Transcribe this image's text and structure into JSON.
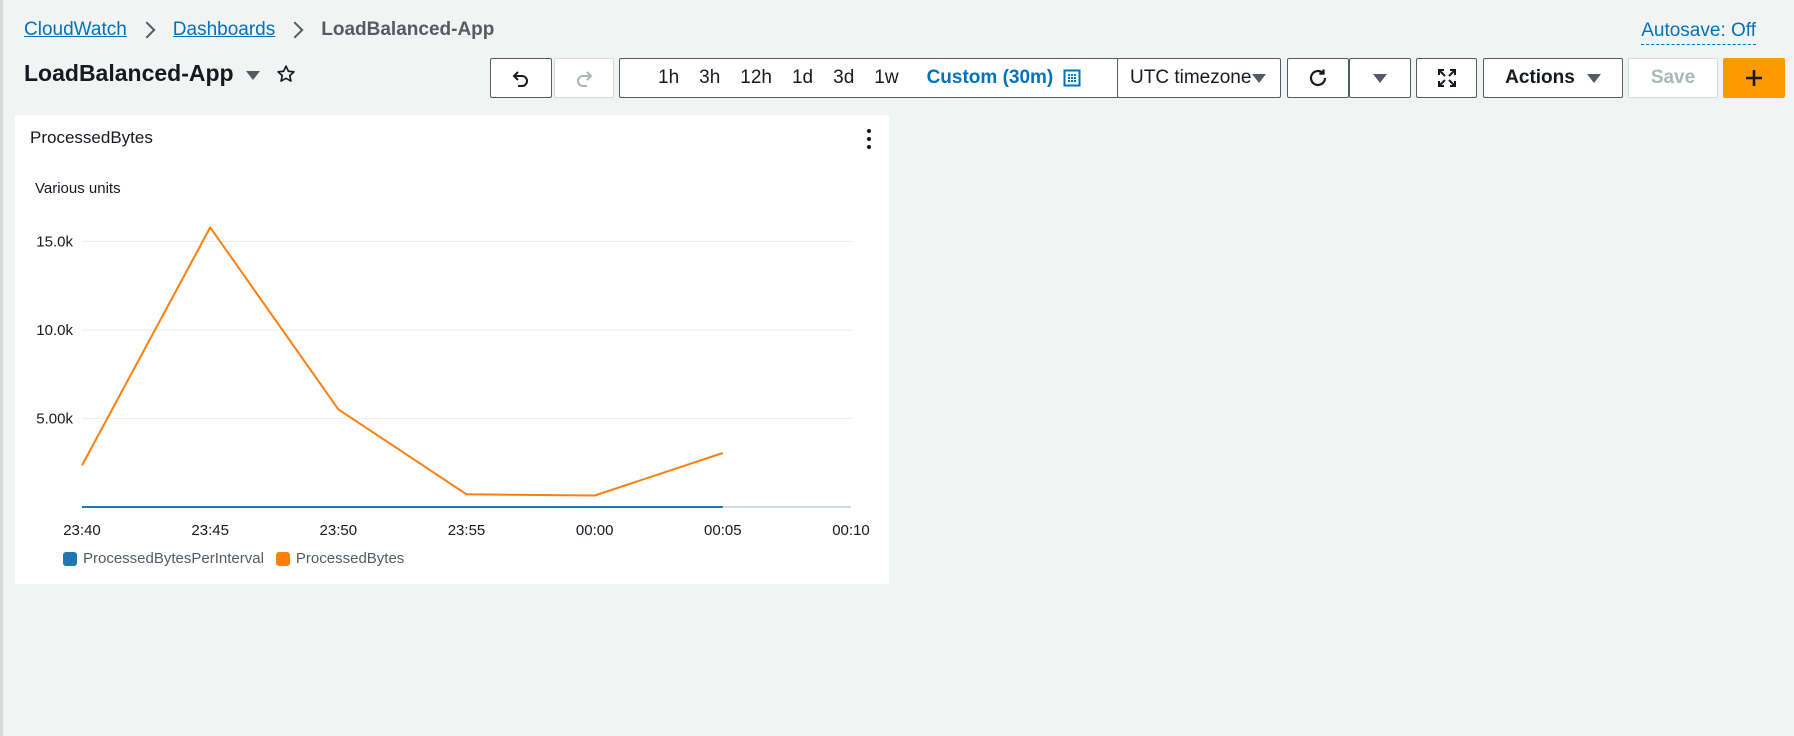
{
  "breadcrumb": {
    "items": [
      "CloudWatch",
      "Dashboards"
    ],
    "current": "LoadBalanced-App"
  },
  "autosave_label": "Autosave: Off",
  "dashboard": {
    "title": "LoadBalanced-App"
  },
  "toolbar": {
    "time_options": [
      "1h",
      "3h",
      "12h",
      "1d",
      "3d",
      "1w"
    ],
    "custom_label": "Custom (30m)",
    "timezone": "UTC timezone",
    "actions_label": "Actions",
    "save_label": "Save",
    "primary_color": "#ff9900"
  },
  "widget": {
    "title": "ProcessedBytes",
    "unit_label": "Various units"
  },
  "chart_data": {
    "type": "line",
    "x": [
      "23:40",
      "23:45",
      "23:50",
      "23:55",
      "00:00",
      "00:05"
    ],
    "x_ticks": [
      "23:40",
      "23:45",
      "23:50",
      "23:55",
      "00:00",
      "00:05",
      "00:10"
    ],
    "y_ticks": [
      5000,
      10000,
      15000
    ],
    "y_tick_labels": [
      "5.00k",
      "10.0k",
      "15.0k"
    ],
    "ylim": [
      0,
      16500
    ],
    "grid": true,
    "legend_position": "bottom-left",
    "ylabel": "Various units",
    "series": [
      {
        "name": "ProcessedBytesPerInterval",
        "color": "#1f77b4",
        "values": [
          0,
          0,
          0,
          0,
          0,
          0
        ]
      },
      {
        "name": "ProcessedBytes",
        "color": "#ff7f0e",
        "values": [
          2350,
          15800,
          5520,
          720,
          650,
          3050
        ]
      }
    ]
  }
}
